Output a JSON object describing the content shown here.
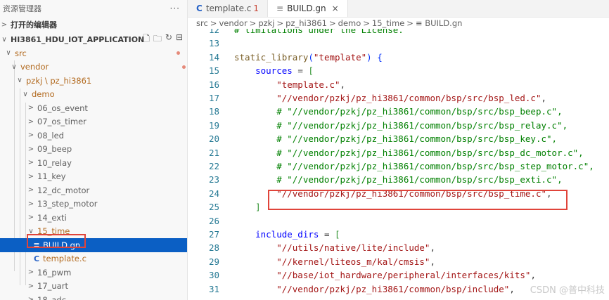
{
  "sidebar": {
    "title": "资源管理器",
    "more": "···",
    "open_editors": "打开的编辑器",
    "project": "HI3861_HDU_IOT_APPLICATION",
    "tree": [
      {
        "label": "src",
        "chev": "∨",
        "indent": 0,
        "dot": true,
        "orange": true
      },
      {
        "label": "vendor",
        "chev": "∨",
        "indent": 1,
        "dot": true,
        "orange": true
      },
      {
        "label": "pzkj \\ pz_hi3861",
        "chev": "∨",
        "indent": 2,
        "dot": true,
        "orange": true
      },
      {
        "label": "demo",
        "chev": "∨",
        "indent": 3,
        "dot": true,
        "orange": true
      },
      {
        "label": "06_os_event",
        "chev": ">",
        "indent": 4
      },
      {
        "label": "07_os_timer",
        "chev": ">",
        "indent": 4
      },
      {
        "label": "08_led",
        "chev": ">",
        "indent": 4
      },
      {
        "label": "09_beep",
        "chev": ">",
        "indent": 4
      },
      {
        "label": "10_relay",
        "chev": ">",
        "indent": 4
      },
      {
        "label": "11_key",
        "chev": ">",
        "indent": 4
      },
      {
        "label": "12_dc_motor",
        "chev": ">",
        "indent": 4
      },
      {
        "label": "13_step_motor",
        "chev": ">",
        "indent": 4
      },
      {
        "label": "14_exti",
        "chev": ">",
        "indent": 4
      },
      {
        "label": "15_time",
        "chev": "∨",
        "indent": 4,
        "dot": true,
        "orange": true
      },
      {
        "label": "BUILD.gn",
        "indent": 5,
        "icon": "≡",
        "selected": true
      },
      {
        "label": "template.c",
        "indent": 5,
        "icon": "C",
        "badge": "1",
        "orange": true
      },
      {
        "label": "16_pwm",
        "chev": ">",
        "indent": 4
      },
      {
        "label": "17_uart",
        "chev": ">",
        "indent": 4
      },
      {
        "label": "18_adc",
        "chev": ">",
        "indent": 4
      }
    ]
  },
  "tabs": [
    {
      "icon": "C",
      "label": "template.c",
      "badge": "1",
      "active": false
    },
    {
      "icon": "≡",
      "label": "BUILD.gn",
      "close": "×",
      "active": true
    }
  ],
  "breadcrumb": [
    "src",
    "vendor",
    "pzkj",
    "pz_hi3861",
    "demo",
    "15_time",
    "≡ BUILD.gn"
  ],
  "code": [
    {
      "n": "12",
      "t": "# limitations under the License.",
      "c": "k-cmt"
    },
    {
      "n": "13",
      "t": ""
    },
    {
      "n": "14",
      "parts": [
        [
          "static_library",
          "k-fn"
        ],
        [
          "(",
          "k-br"
        ],
        [
          "\"template\"",
          "k-str"
        ],
        [
          ") {",
          "k-br"
        ]
      ]
    },
    {
      "n": "15",
      "parts": [
        [
          "    sources",
          "k-prop"
        ],
        [
          " = ",
          "k-def"
        ],
        [
          "[",
          "k-br2"
        ]
      ]
    },
    {
      "n": "16",
      "parts": [
        [
          "        \"template.c\"",
          "k-str"
        ],
        [
          ",",
          "k-def"
        ]
      ]
    },
    {
      "n": "17",
      "parts": [
        [
          "        \"//vendor/pzkj/pz_hi3861/common/bsp/src/bsp_led.c\"",
          "k-str"
        ],
        [
          ",",
          "k-def"
        ]
      ]
    },
    {
      "n": "18",
      "t": "        # \"//vendor/pzkj/pz_hi3861/common/bsp/src/bsp_beep.c\",",
      "c": "k-cmt"
    },
    {
      "n": "19",
      "t": "        # \"//vendor/pzkj/pz_hi3861/common/bsp/src/bsp_relay.c\",",
      "c": "k-cmt"
    },
    {
      "n": "20",
      "t": "        # \"//vendor/pzkj/pz_hi3861/common/bsp/src/bsp_key.c\",",
      "c": "k-cmt"
    },
    {
      "n": "21",
      "t": "        # \"//vendor/pzkj/pz_hi3861/common/bsp/src/bsp_dc_motor.c\",",
      "c": "k-cmt"
    },
    {
      "n": "22",
      "t": "        # \"//vendor/pzkj/pz_hi3861/common/bsp/src/bsp_step_motor.c\",",
      "c": "k-cmt"
    },
    {
      "n": "23",
      "t": "        # \"//vendor/pzkj/pz_hi3861/common/bsp/src/bsp_exti.c\",",
      "c": "k-cmt"
    },
    {
      "n": "24",
      "parts": [
        [
          "        \"//vendor/pzkj/pz_hi3861/common/bsp/src/bsp_time.c\"",
          "k-str"
        ],
        [
          ",",
          "k-def"
        ]
      ]
    },
    {
      "n": "25",
      "parts": [
        [
          "    ]",
          "k-br2"
        ]
      ]
    },
    {
      "n": "26",
      "t": ""
    },
    {
      "n": "27",
      "parts": [
        [
          "    include_dirs",
          "k-prop"
        ],
        [
          " = ",
          "k-def"
        ],
        [
          "[",
          "k-br2"
        ]
      ]
    },
    {
      "n": "28",
      "parts": [
        [
          "        \"//utils/native/lite/include\"",
          "k-str"
        ],
        [
          ",",
          "k-def"
        ]
      ]
    },
    {
      "n": "29",
      "parts": [
        [
          "        \"//kernel/liteos_m/kal/cmsis\"",
          "k-str"
        ],
        [
          ",",
          "k-def"
        ]
      ]
    },
    {
      "n": "30",
      "parts": [
        [
          "        \"//base/iot_hardware/peripheral/interfaces/kits\"",
          "k-str"
        ],
        [
          ",",
          "k-def"
        ]
      ]
    },
    {
      "n": "31",
      "parts": [
        [
          "        \"//vendor/pzkj/pz_hi3861/common/bsp/include\"",
          "k-str"
        ],
        [
          ",",
          "k-def"
        ]
      ]
    }
  ],
  "watermark": "CSDN @普中科技"
}
